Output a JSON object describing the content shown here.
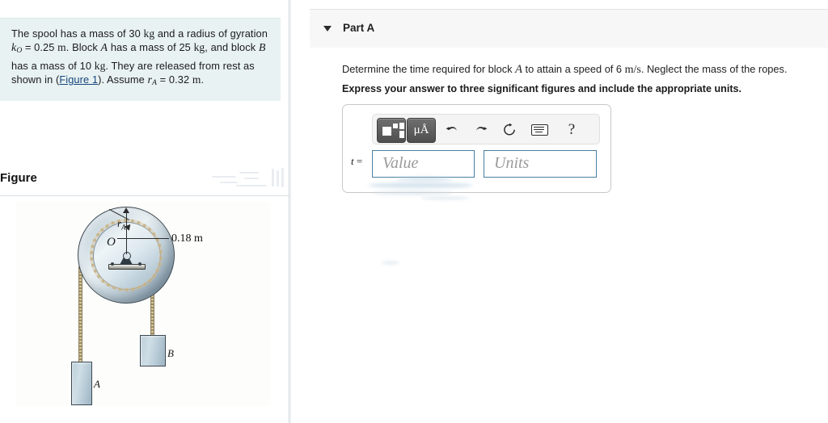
{
  "problem": {
    "line1_a": "The spool has a mass of 30 ",
    "unit_kg1": "kg",
    "line1_b": " and a radius of gyration",
    "k_symbol": "k",
    "k_sub": "O",
    "k_value": " = 0.25 ",
    "unit_m1": "m",
    "line2_b": ". Block ",
    "block_a": "A",
    "line2_c": " has a mass of 25 ",
    "unit_kg2": "kg",
    "line2_d": ", and block",
    "block_b": "B",
    "line3_b": " has a mass of 10 ",
    "unit_kg3": "kg",
    "line3_c": ". They are released from rest as",
    "line4_a": "shown in (",
    "figure_link": "Figure 1",
    "line4_b": "). Assume ",
    "r_symbol": "r",
    "r_sub": "A",
    "r_value": " = 0.32 ",
    "unit_m2": "m",
    "period": "."
  },
  "figure": {
    "title": "Figure",
    "dimension_label": "0.18 m",
    "center_label": "O",
    "radius_label": "r",
    "radius_sub": "A",
    "block_a_label": "A",
    "block_b_label": "B"
  },
  "part": {
    "title": "Part A",
    "question_a": "Determine the time required for block ",
    "question_var": "A",
    "question_b": " to attain a speed of 6 ",
    "question_unit": "m/s",
    "question_c": ". Neglect the mass of the ropes.",
    "instruction": "Express your answer to three significant figures and include the appropriate units."
  },
  "answer": {
    "variable": "t",
    "equals": " =",
    "value_placeholder": "Value",
    "units_placeholder": "Units",
    "toolbar": {
      "template_label": "",
      "units_label": "μÅ",
      "undo": "↶",
      "redo": "↷",
      "reset": "↻",
      "help": "?"
    }
  },
  "colors": {
    "problem_bg": "#e8f2f2",
    "link": "#16467c",
    "field_border": "#4a7fa0",
    "header_bg": "#f7f7f7"
  }
}
